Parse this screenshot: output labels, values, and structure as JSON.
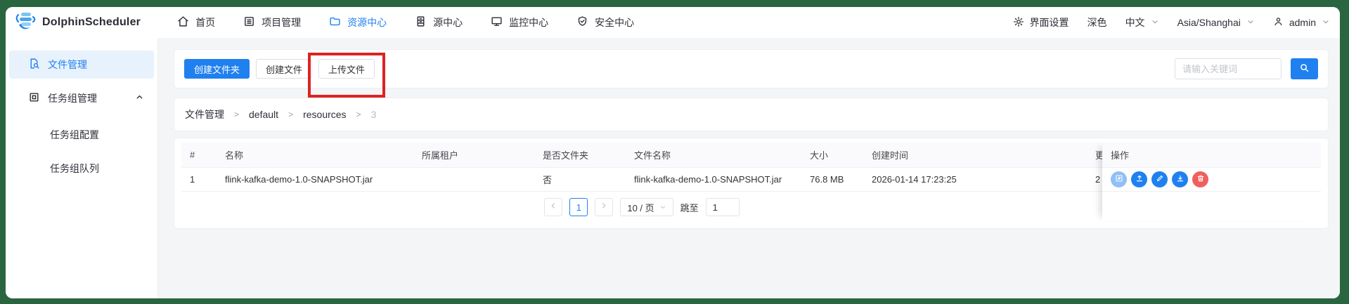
{
  "navbar": {
    "brand": "DolphinScheduler",
    "items": [
      {
        "label": "首页"
      },
      {
        "label": "项目管理"
      },
      {
        "label": "资源中心"
      },
      {
        "label": "源中心"
      },
      {
        "label": "监控中心"
      },
      {
        "label": "安全中心"
      }
    ],
    "settings": "界面设置",
    "theme": "深色",
    "language": "中文",
    "timezone": "Asia/Shanghai",
    "user": "admin"
  },
  "sidebar": {
    "file_manage": "文件管理",
    "task_group_manage": "任务组管理",
    "task_group_option": "任务组配置",
    "task_group_queue": "任务组队列"
  },
  "toolbar": {
    "create_folder": "创建文件夹",
    "create_file": "创建文件",
    "upload_file": "上传文件",
    "search_placeholder": "请输入关键词"
  },
  "breadcrumb": {
    "separator": ">",
    "items": [
      "文件管理",
      "default",
      "resources",
      "3"
    ]
  },
  "table": {
    "headers": {
      "index": "#",
      "name": "名称",
      "tenant": "所属租户",
      "is_folder": "是否文件夹",
      "file_name": "文件名称",
      "size": "大小",
      "create_time": "创建时间",
      "update_time_clipped": "更",
      "operation": "操作"
    },
    "rows": [
      {
        "index": "1",
        "name": "flink-kafka-demo-1.0-SNAPSHOT.jar",
        "tenant": "",
        "is_folder": "否",
        "file_name": "flink-kafka-demo-1.0-SNAPSHOT.jar",
        "size": "76.8 MB",
        "create_time": "2026-01-14 17:23:25",
        "update_time_clipped": "2"
      }
    ]
  },
  "pagination": {
    "current_page": "1",
    "page_size": "10 / 页",
    "jump_to": "跳至",
    "jump_value": "1"
  },
  "colors": {
    "primary": "#2080f0",
    "frame_green": "#29663f",
    "annotation_red": "#dd2323",
    "delete_red": "#f05f5f",
    "sidebar_active_bg": "#e8f2fd"
  }
}
